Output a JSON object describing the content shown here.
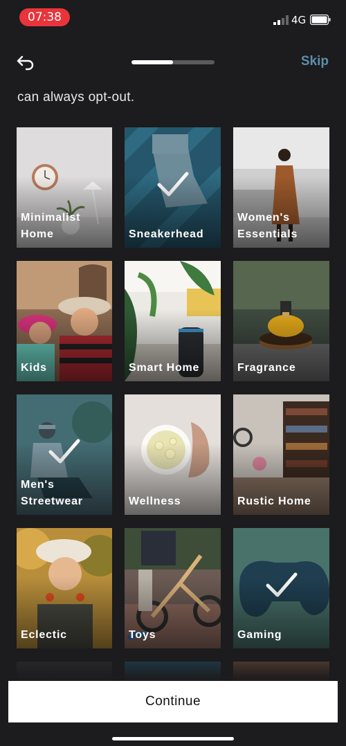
{
  "status_bar": {
    "time": "07:38",
    "network": "4G",
    "time_pill_color": "#e8343a"
  },
  "nav": {
    "skip_label": "Skip",
    "progress": 0.5,
    "accent": "#5b8fae"
  },
  "intro_text": "can always opt-out.",
  "categories": [
    {
      "label": "Minimalist\nHome",
      "selected": false
    },
    {
      "label": "Sneakerhead",
      "selected": true
    },
    {
      "label": "Women's\nEssentials",
      "selected": false
    },
    {
      "label": "Kids",
      "selected": false
    },
    {
      "label": "Smart Home",
      "selected": false
    },
    {
      "label": "Fragrance",
      "selected": false
    },
    {
      "label": "Men's\nStreetwear",
      "selected": true
    },
    {
      "label": "Wellness",
      "selected": false
    },
    {
      "label": "Rustic Home",
      "selected": false
    },
    {
      "label": "Eclectic",
      "selected": false
    },
    {
      "label": "Toys",
      "selected": false
    },
    {
      "label": "Gaming",
      "selected": true
    }
  ],
  "continue_label": "Continue"
}
